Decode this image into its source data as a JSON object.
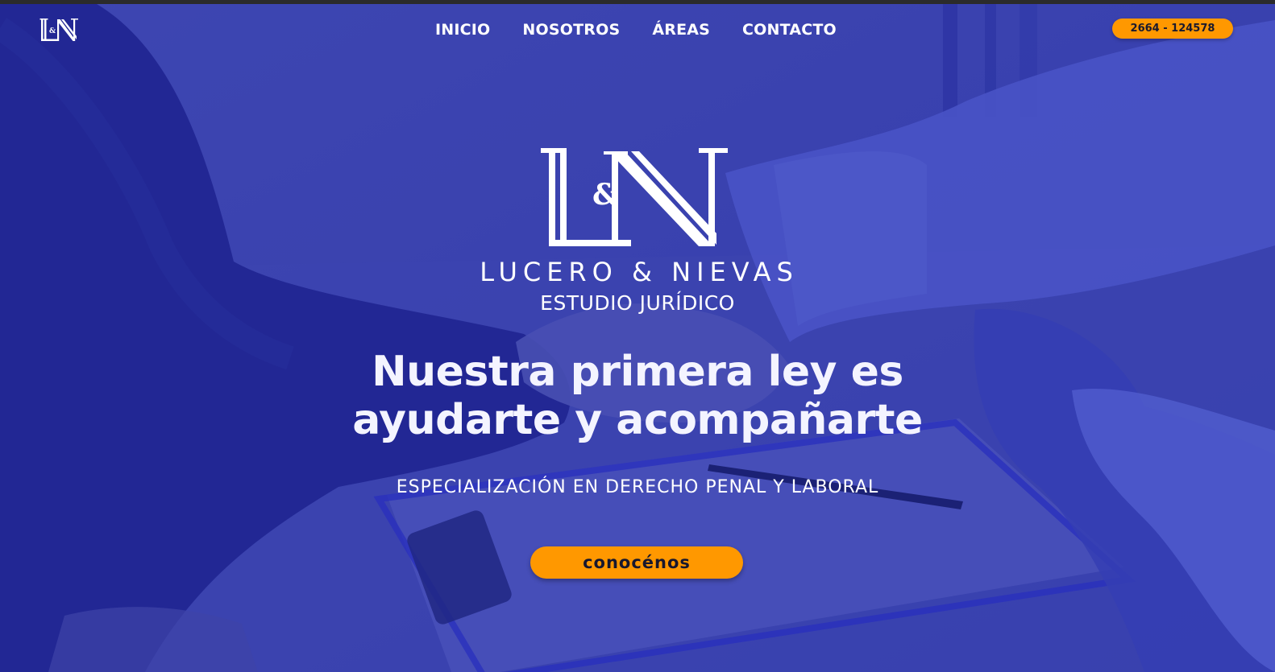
{
  "nav": {
    "logo_text": "L&N",
    "items": [
      {
        "label": "INICIO"
      },
      {
        "label": "NOSOTROS"
      },
      {
        "label": "ÁREAS"
      },
      {
        "label": "CONTACTO"
      }
    ],
    "phone": "2664 - 124578"
  },
  "hero": {
    "logo_text": "L&N",
    "brand_name": "LUCERO & NIEVAS",
    "brand_subtitle": "ESTUDIO JURÍDICO",
    "headline_line1": "Nuestra primera ley es",
    "headline_line2": "ayudarte y acompañarte",
    "tagline": "ESPECIALIZACIÓN EN DERECHO PENAL Y LABORAL",
    "cta_label": "conocénos"
  },
  "colors": {
    "overlay": "#3a40a8",
    "accent": "#ff9800",
    "text": "#ffffff"
  },
  "icons": {
    "nav_logo": "ln-monogram-logo",
    "hero_logo": "ln-monogram-logo"
  }
}
